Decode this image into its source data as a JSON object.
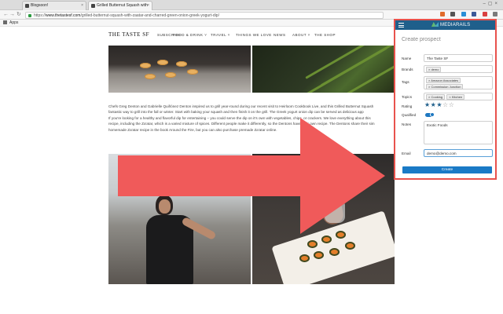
{
  "browser": {
    "tabs": [
      {
        "label": "Blogsoon!"
      },
      {
        "label": "Grilled Butternut Squash with"
      }
    ],
    "url_prefix": "https://",
    "url_domain": "www.thetastesf.com",
    "url_path": "/grilled-butternut-squash-with-zaatar-and-charred-green-onion-greek-yogurt-dip/",
    "bookmarks_label": "Apps"
  },
  "site": {
    "logo": "THE TASTE SF",
    "nav": [
      "SUBSCRIBE",
      "FOOD & DRINK ˅",
      "TRAVEL ˅",
      "THINGS WE LOVE",
      "NEWS",
      "ABOUT ˅",
      "THE SHOP"
    ],
    "article_lines": [
      "Chefs Greg Denton and Gabrielle Quiñónez Denton inspired us to grill year-round during our recent visit to Heirloom Cookbook Live, and this Grilled Butternut Squash",
      "fantastic way to grill into the fall or winter. Start with baking your squash and then finish it on the grill. The Greek yogurt onion dip can be served as delicious app",
      "If you're looking for a healthy and flavorful dip for entertaining – you could serve the dip on it's own with vegetables, chips, or crackers. We love everything about this",
      "recipe, including the Za'atar, which is a varied mixture of spices. Different people make it differently, so the Dentons have their own recipe. The Dentons share their sim",
      "homemade Za'atar recipe in the book Around the Fire, but you can also purchase premade Za'atar online."
    ]
  },
  "extension": {
    "brand": "MEDIARAILS",
    "title": "Create prospect",
    "fields": {
      "name_label": "Name",
      "name_value": "The Taste SF",
      "brands_label": "Brands",
      "brands": [
        "demo"
      ],
      "tags_label": "Tags",
      "tags": [
        "Amazon Associates",
        "Commission Junction"
      ],
      "topics_label": "Topics",
      "topics": [
        "Cooking",
        "Kitchen"
      ],
      "rating_label": "Rating",
      "rating_value": 3,
      "rating_max": 5,
      "qualified_label": "Qualified",
      "qualified_on": true,
      "notes_label": "Notes",
      "notes_value": "Exotic Foods",
      "email_label": "Email",
      "email_value": "demo@demo.com"
    },
    "create_label": "Create"
  },
  "colors": {
    "brand_blue": "#1f5f8b",
    "button_blue": "#1a7ac6",
    "popup_border": "#e8524d",
    "arrow_red": "#f05a5a"
  }
}
